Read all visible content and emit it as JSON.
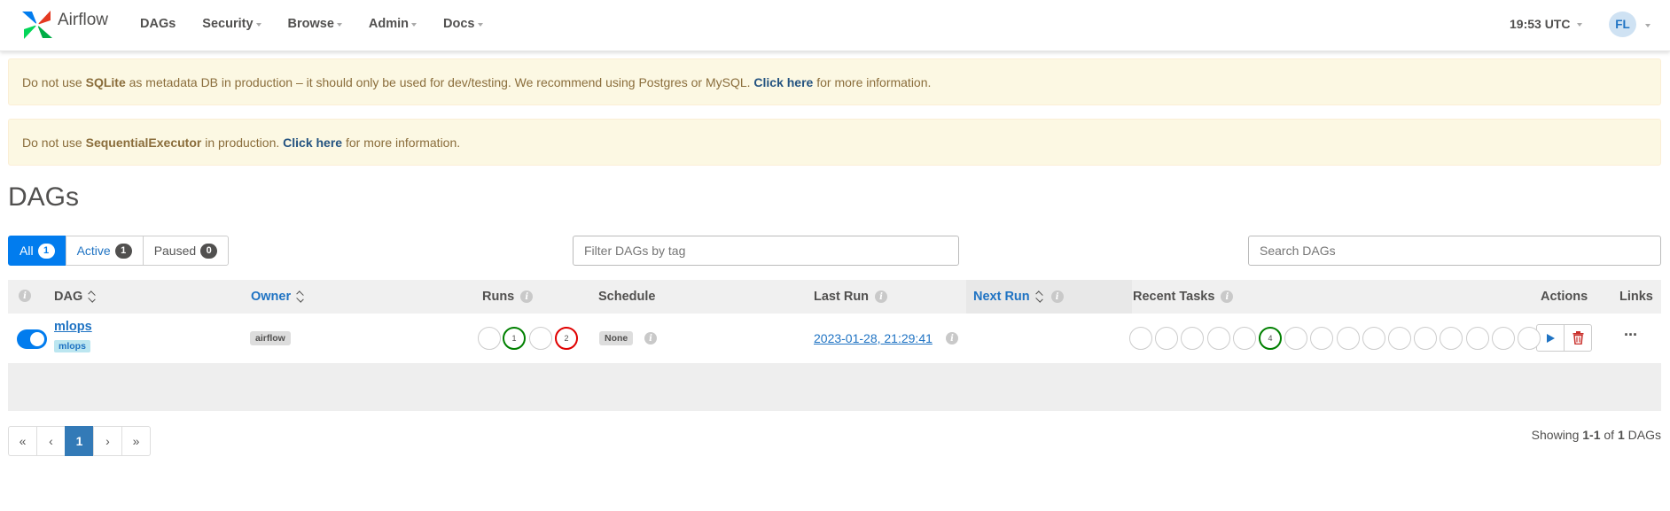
{
  "navbar": {
    "brand": "Airflow",
    "items": [
      {
        "label": "DAGs",
        "dropdown": false
      },
      {
        "label": "Security",
        "dropdown": true
      },
      {
        "label": "Browse",
        "dropdown": true
      },
      {
        "label": "Admin",
        "dropdown": true
      },
      {
        "label": "Docs",
        "dropdown": true
      }
    ],
    "time": "19:53 UTC",
    "user_initials": "FL"
  },
  "alerts": [
    {
      "pre": "Do not use ",
      "bold": "SQLite",
      "mid": " as metadata DB in production – it should only be used for dev/testing. We recommend using Postgres or MySQL. ",
      "link": "Click here",
      "post": " for more information."
    },
    {
      "pre": "Do not use ",
      "bold": "SequentialExecutor",
      "mid": " in production. ",
      "link": "Click here",
      "post": " for more information."
    }
  ],
  "page_title": "DAGs",
  "filters": [
    {
      "label": "All",
      "count": "1",
      "active": true
    },
    {
      "label": "Active",
      "count": "1",
      "active": false
    },
    {
      "label": "Paused",
      "count": "0",
      "active": false
    }
  ],
  "tag_filter": {
    "placeholder": "Filter DAGs by tag"
  },
  "search": {
    "placeholder": "Search DAGs"
  },
  "table": {
    "headers": {
      "dag": "DAG",
      "owner": "Owner",
      "runs": "Runs",
      "schedule": "Schedule",
      "last_run": "Last Run",
      "next_run": "Next Run",
      "recent_tasks": "Recent Tasks",
      "actions": "Actions",
      "links": "Links"
    },
    "rows": [
      {
        "paused": false,
        "name": "mlops",
        "tag": "mlops",
        "owner": "airflow",
        "runs": [
          {
            "state": "queued",
            "count": ""
          },
          {
            "state": "success",
            "count": "1",
            "color": "#008000"
          },
          {
            "state": "running",
            "count": ""
          },
          {
            "state": "failed",
            "count": "2",
            "color": "#e00000"
          }
        ],
        "schedule": "None",
        "last_run": "2023-01-28, 21:29:41",
        "next_run": "",
        "recent_tasks": [
          "",
          "",
          "",
          "",
          "",
          "4",
          "",
          "",
          "",
          "",
          "",
          "",
          "",
          "",
          "",
          ""
        ],
        "recent_tasks_highlight_index": 5
      }
    ]
  },
  "pagination": {
    "first": "«",
    "prev": "‹",
    "current": "1",
    "next": "›",
    "last": "»"
  },
  "showing": {
    "prefix": "Showing ",
    "range": "1-1",
    "of": " of ",
    "total": "1",
    "suffix": " DAGs"
  },
  "colors": {
    "primary": "#017cee",
    "link": "#1f73c3",
    "alert_bg": "#fcf8e3",
    "success": "#008000",
    "failed": "#e00000",
    "delete": "#c9302c"
  }
}
